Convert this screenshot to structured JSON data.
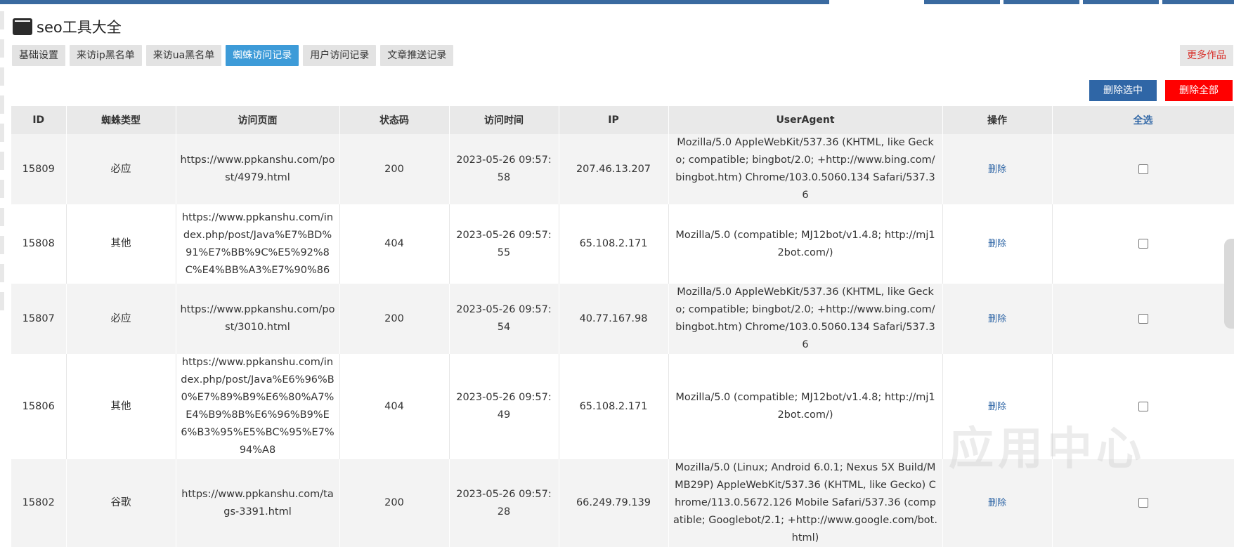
{
  "header": {
    "icon": "window-icon",
    "title": "seo工具大全"
  },
  "tabs": [
    {
      "label": "基础设置",
      "active": false
    },
    {
      "label": "来访ip黑名单",
      "active": false
    },
    {
      "label": "来访ua黑名单",
      "active": false
    },
    {
      "label": "蜘蛛访问记录",
      "active": true
    },
    {
      "label": "用户访问记录",
      "active": false
    },
    {
      "label": "文章推送记录",
      "active": false
    }
  ],
  "more_button": "更多作品",
  "actions": {
    "delete_selected": "删除选中",
    "delete_all": "删除全部"
  },
  "table": {
    "headers": {
      "id": "ID",
      "spider": "蜘蛛类型",
      "page": "访问页面",
      "status": "状态码",
      "time": "访问时间",
      "ip": "IP",
      "ua": "UserAgent",
      "op": "操作",
      "select_all": "全选"
    },
    "rows": [
      {
        "id": "15809",
        "spider": "必应",
        "page": "https://www.ppkanshu.com/post/4979.html",
        "status": "200",
        "time": "2023-05-26 09:57:58",
        "ip": "207.46.13.207",
        "ua": "Mozilla/5.0 AppleWebKit/537.36 (KHTML, like Gecko; compatible; bingbot/2.0; +http://www.bing.com/bingbot.htm) Chrome/103.0.5060.134 Safari/537.36",
        "op": "删除"
      },
      {
        "id": "15808",
        "spider": "其他",
        "page": "https://www.ppkanshu.com/index.php/post/Java%E7%BD%91%E7%BB%9C%E5%92%8C%E4%BB%A3%E7%90%86",
        "status": "404",
        "time": "2023-05-26 09:57:55",
        "ip": "65.108.2.171",
        "ua": "Mozilla/5.0 (compatible; MJ12bot/v1.4.8; http://mj12bot.com/)",
        "op": "删除"
      },
      {
        "id": "15807",
        "spider": "必应",
        "page": "https://www.ppkanshu.com/post/3010.html",
        "status": "200",
        "time": "2023-05-26 09:57:54",
        "ip": "40.77.167.98",
        "ua": "Mozilla/5.0 AppleWebKit/537.36 (KHTML, like Gecko; compatible; bingbot/2.0; +http://www.bing.com/bingbot.htm) Chrome/103.0.5060.134 Safari/537.36",
        "op": "删除"
      },
      {
        "id": "15806",
        "spider": "其他",
        "page": "https://www.ppkanshu.com/index.php/post/Java%E6%96%B0%E7%89%B9%E6%80%A7%E4%B9%8B%E6%96%B9%E6%B3%95%E5%BC%95%E7%94%A8",
        "status": "404",
        "time": "2023-05-26 09:57:49",
        "ip": "65.108.2.171",
        "ua": "Mozilla/5.0 (compatible; MJ12bot/v1.4.8; http://mj12bot.com/)",
        "op": "删除"
      },
      {
        "id": "15802",
        "spider": "谷歌",
        "page": "https://www.ppkanshu.com/tags-3391.html",
        "status": "200",
        "time": "2023-05-26 09:57:28",
        "ip": "66.249.79.139",
        "ua": "Mozilla/5.0 (Linux; Android 6.0.1; Nexus 5X Build/MMB29P) AppleWebKit/537.36 (KHTML, like Gecko) Chrome/113.0.5672.126 Mobile Safari/537.36 (compatible; Googlebot/2.1; +http://www.google.com/bot.html)",
        "op": "删除"
      }
    ]
  },
  "watermark": "应用中心",
  "colors": {
    "accent": "#3d9bd8",
    "primary_button": "#2f66a6",
    "danger_button": "#ff0000",
    "more_text": "#d8322c"
  }
}
